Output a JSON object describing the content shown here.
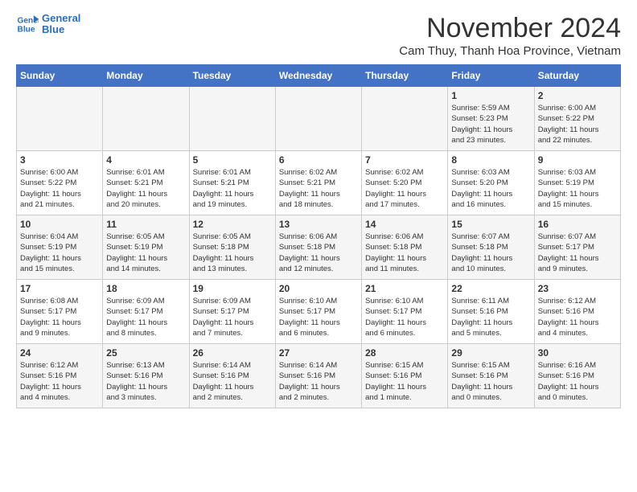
{
  "logo": {
    "line1": "General",
    "line2": "Blue"
  },
  "title": "November 2024",
  "location": "Cam Thuy, Thanh Hoa Province, Vietnam",
  "weekdays": [
    "Sunday",
    "Monday",
    "Tuesday",
    "Wednesday",
    "Thursday",
    "Friday",
    "Saturday"
  ],
  "weeks": [
    [
      {
        "day": "",
        "info": ""
      },
      {
        "day": "",
        "info": ""
      },
      {
        "day": "",
        "info": ""
      },
      {
        "day": "",
        "info": ""
      },
      {
        "day": "",
        "info": ""
      },
      {
        "day": "1",
        "info": "Sunrise: 5:59 AM\nSunset: 5:23 PM\nDaylight: 11 hours\nand 23 minutes."
      },
      {
        "day": "2",
        "info": "Sunrise: 6:00 AM\nSunset: 5:22 PM\nDaylight: 11 hours\nand 22 minutes."
      }
    ],
    [
      {
        "day": "3",
        "info": "Sunrise: 6:00 AM\nSunset: 5:22 PM\nDaylight: 11 hours\nand 21 minutes."
      },
      {
        "day": "4",
        "info": "Sunrise: 6:01 AM\nSunset: 5:21 PM\nDaylight: 11 hours\nand 20 minutes."
      },
      {
        "day": "5",
        "info": "Sunrise: 6:01 AM\nSunset: 5:21 PM\nDaylight: 11 hours\nand 19 minutes."
      },
      {
        "day": "6",
        "info": "Sunrise: 6:02 AM\nSunset: 5:21 PM\nDaylight: 11 hours\nand 18 minutes."
      },
      {
        "day": "7",
        "info": "Sunrise: 6:02 AM\nSunset: 5:20 PM\nDaylight: 11 hours\nand 17 minutes."
      },
      {
        "day": "8",
        "info": "Sunrise: 6:03 AM\nSunset: 5:20 PM\nDaylight: 11 hours\nand 16 minutes."
      },
      {
        "day": "9",
        "info": "Sunrise: 6:03 AM\nSunset: 5:19 PM\nDaylight: 11 hours\nand 15 minutes."
      }
    ],
    [
      {
        "day": "10",
        "info": "Sunrise: 6:04 AM\nSunset: 5:19 PM\nDaylight: 11 hours\nand 15 minutes."
      },
      {
        "day": "11",
        "info": "Sunrise: 6:05 AM\nSunset: 5:19 PM\nDaylight: 11 hours\nand 14 minutes."
      },
      {
        "day": "12",
        "info": "Sunrise: 6:05 AM\nSunset: 5:18 PM\nDaylight: 11 hours\nand 13 minutes."
      },
      {
        "day": "13",
        "info": "Sunrise: 6:06 AM\nSunset: 5:18 PM\nDaylight: 11 hours\nand 12 minutes."
      },
      {
        "day": "14",
        "info": "Sunrise: 6:06 AM\nSunset: 5:18 PM\nDaylight: 11 hours\nand 11 minutes."
      },
      {
        "day": "15",
        "info": "Sunrise: 6:07 AM\nSunset: 5:18 PM\nDaylight: 11 hours\nand 10 minutes."
      },
      {
        "day": "16",
        "info": "Sunrise: 6:07 AM\nSunset: 5:17 PM\nDaylight: 11 hours\nand 9 minutes."
      }
    ],
    [
      {
        "day": "17",
        "info": "Sunrise: 6:08 AM\nSunset: 5:17 PM\nDaylight: 11 hours\nand 9 minutes."
      },
      {
        "day": "18",
        "info": "Sunrise: 6:09 AM\nSunset: 5:17 PM\nDaylight: 11 hours\nand 8 minutes."
      },
      {
        "day": "19",
        "info": "Sunrise: 6:09 AM\nSunset: 5:17 PM\nDaylight: 11 hours\nand 7 minutes."
      },
      {
        "day": "20",
        "info": "Sunrise: 6:10 AM\nSunset: 5:17 PM\nDaylight: 11 hours\nand 6 minutes."
      },
      {
        "day": "21",
        "info": "Sunrise: 6:10 AM\nSunset: 5:17 PM\nDaylight: 11 hours\nand 6 minutes."
      },
      {
        "day": "22",
        "info": "Sunrise: 6:11 AM\nSunset: 5:16 PM\nDaylight: 11 hours\nand 5 minutes."
      },
      {
        "day": "23",
        "info": "Sunrise: 6:12 AM\nSunset: 5:16 PM\nDaylight: 11 hours\nand 4 minutes."
      }
    ],
    [
      {
        "day": "24",
        "info": "Sunrise: 6:12 AM\nSunset: 5:16 PM\nDaylight: 11 hours\nand 4 minutes."
      },
      {
        "day": "25",
        "info": "Sunrise: 6:13 AM\nSunset: 5:16 PM\nDaylight: 11 hours\nand 3 minutes."
      },
      {
        "day": "26",
        "info": "Sunrise: 6:14 AM\nSunset: 5:16 PM\nDaylight: 11 hours\nand 2 minutes."
      },
      {
        "day": "27",
        "info": "Sunrise: 6:14 AM\nSunset: 5:16 PM\nDaylight: 11 hours\nand 2 minutes."
      },
      {
        "day": "28",
        "info": "Sunrise: 6:15 AM\nSunset: 5:16 PM\nDaylight: 11 hours\nand 1 minute."
      },
      {
        "day": "29",
        "info": "Sunrise: 6:15 AM\nSunset: 5:16 PM\nDaylight: 11 hours\nand 0 minutes."
      },
      {
        "day": "30",
        "info": "Sunrise: 6:16 AM\nSunset: 5:16 PM\nDaylight: 11 hours\nand 0 minutes."
      }
    ]
  ]
}
